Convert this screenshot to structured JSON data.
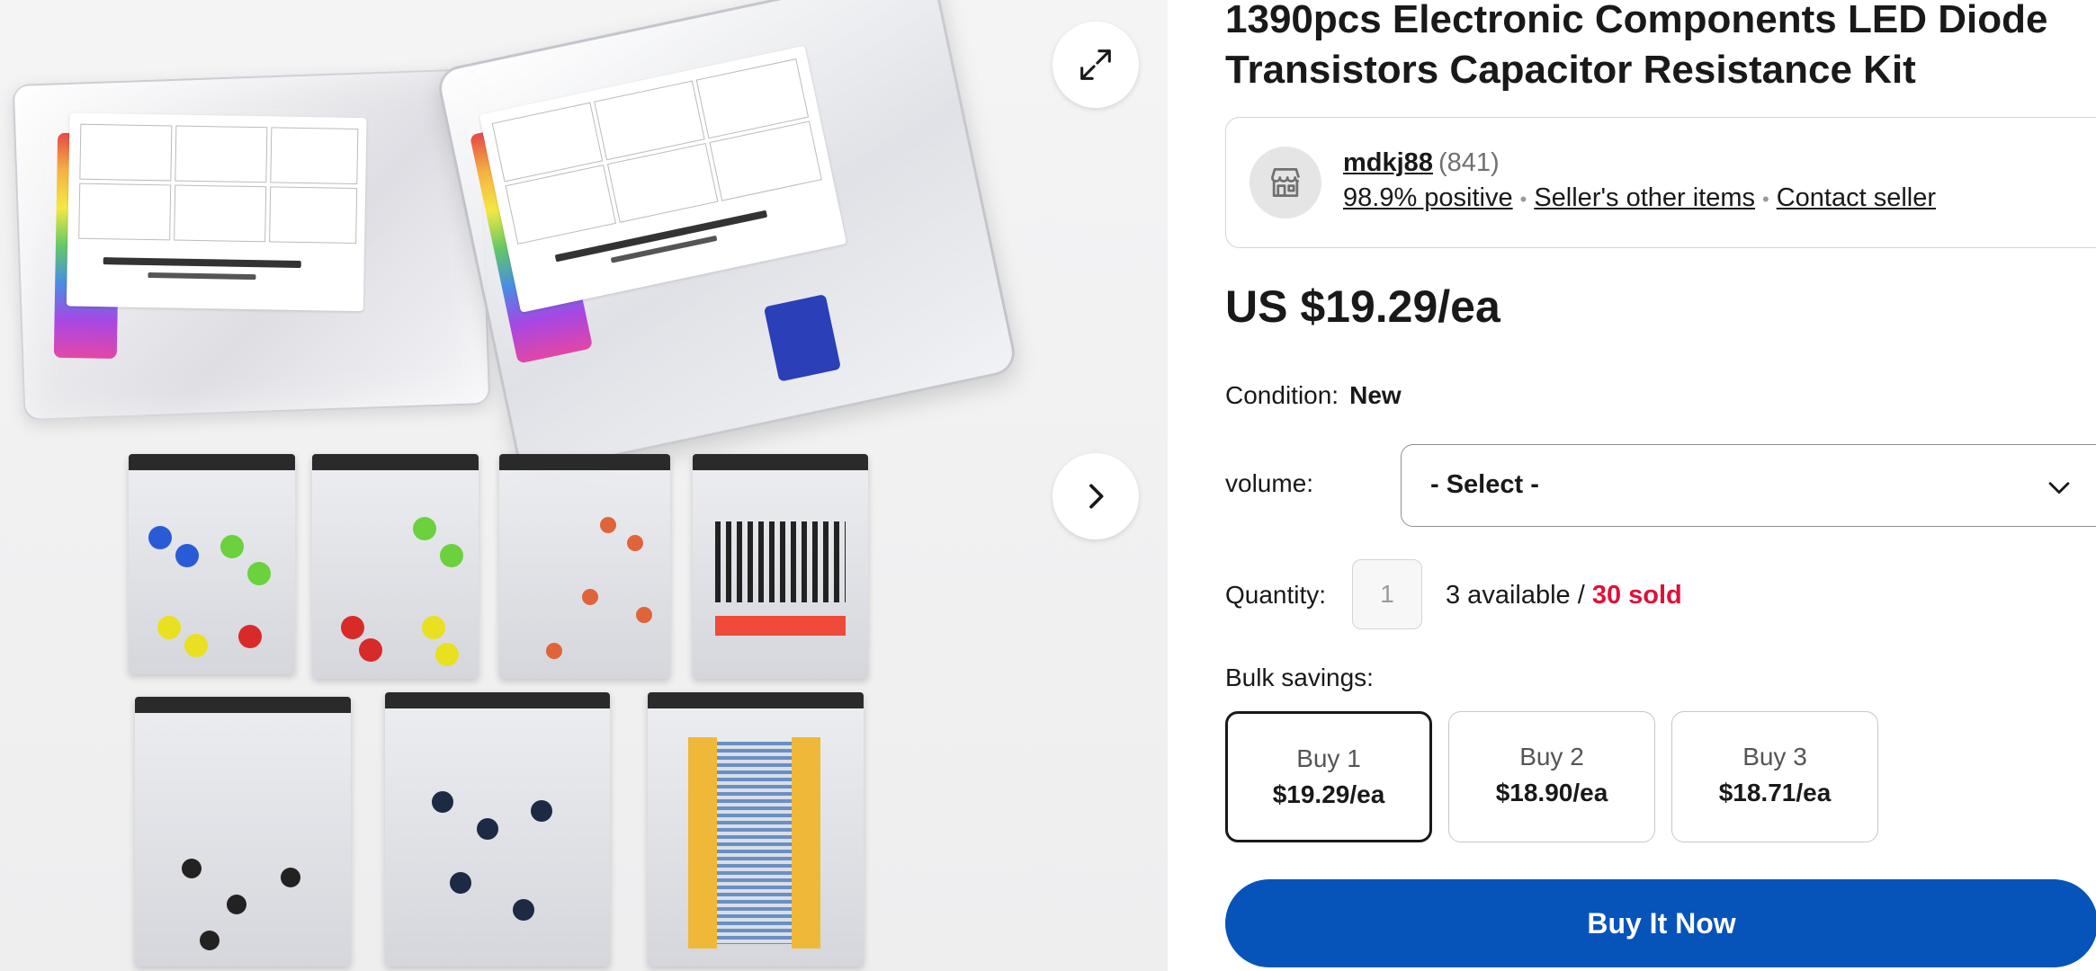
{
  "listing": {
    "title": "1390pcs Electronic Components LED Diode Transistors Capacitor Resistance Kit",
    "price": "US $19.29/ea"
  },
  "seller": {
    "name": "mdkj88",
    "feedback_count": "(841)",
    "positive": "98.9% positive",
    "other_items": "Seller's other items",
    "contact": "Contact seller"
  },
  "condition": {
    "label": "Condition:",
    "value": "New"
  },
  "variation": {
    "label": "volume:",
    "selected": "- Select -"
  },
  "quantity": {
    "label": "Quantity:",
    "value": "1",
    "available": "3 available / ",
    "sold": "30 sold"
  },
  "bulk": {
    "label": "Bulk savings:",
    "options": [
      {
        "qty": "Buy 1",
        "price": "$19.29/ea"
      },
      {
        "qty": "Buy 2",
        "price": "$18.90/ea"
      },
      {
        "qty": "Buy 3",
        "price": "$18.71/ea"
      }
    ],
    "selected_index": 0
  },
  "actions": {
    "buy_now": "Buy It Now"
  },
  "icons": {
    "expand": "expand-icon",
    "next": "chevron-right-icon",
    "store": "store-icon",
    "dropdown": "chevron-down-icon"
  },
  "colors": {
    "primary_blue": "#0654ba",
    "sold_red": "#e0103a",
    "text": "#191919",
    "gallery_bg": "#f2f2f2"
  }
}
